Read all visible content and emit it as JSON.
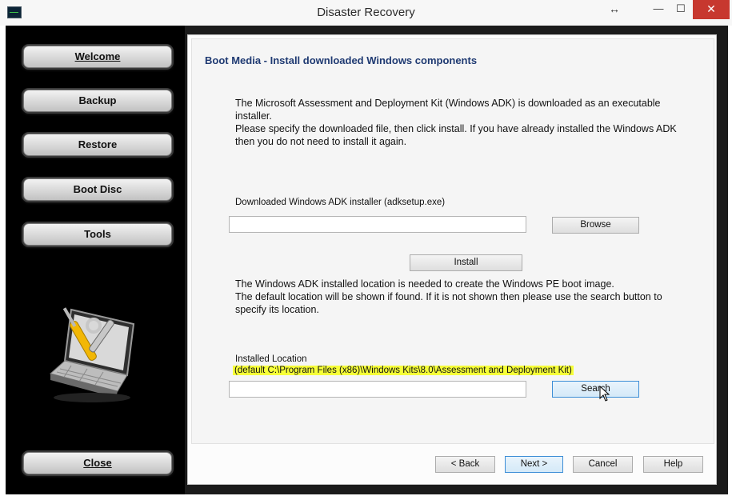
{
  "window": {
    "title": "Disaster Recovery",
    "controls": {
      "resize": "↔",
      "minimize": "—",
      "maximize": "☐",
      "close": "✕"
    }
  },
  "sidebar": {
    "items": [
      {
        "label": "Welcome"
      },
      {
        "label": "Backup"
      },
      {
        "label": "Restore"
      },
      {
        "label": "Boot Disc"
      },
      {
        "label": "Tools"
      }
    ],
    "close_label": "Close",
    "illustration": "laptop-with-tools-icon"
  },
  "main": {
    "heading": "Boot Media - Install downloaded Windows components",
    "intro_lines": [
      "The Microsoft Assessment and Deployment Kit (Windows ADK) is downloaded as an executable",
      "installer.",
      "Please specify the downloaded file, then click install. If you have already installed the Windows ADK",
      "then you do not need to install it again."
    ],
    "installer_label": "Downloaded Windows ADK installer (adksetup.exe)",
    "installer_value": "",
    "browse_label": "Browse",
    "install_label": "Install",
    "location_lines": [
      "The Windows ADK installed location is needed to create the Windows PE boot image.",
      "The default location will be shown if found. If it is not shown then please use the search button to",
      "specify its location."
    ],
    "installed_location_label": "Installed Location",
    "default_location_note": "(default C:\\Program Files (x86)\\Windows Kits\\8.0\\Assessment and Deployment Kit)",
    "location_value": "",
    "search_label": "Search"
  },
  "footer": {
    "back_label": "< Back",
    "next_label": "Next >",
    "cancel_label": "Cancel",
    "help_label": "Help"
  },
  "colors": {
    "heading": "#1f3a72",
    "highlight": "#f6ff38",
    "close_button": "#c7382f",
    "sidebar_bg": "#000000"
  }
}
